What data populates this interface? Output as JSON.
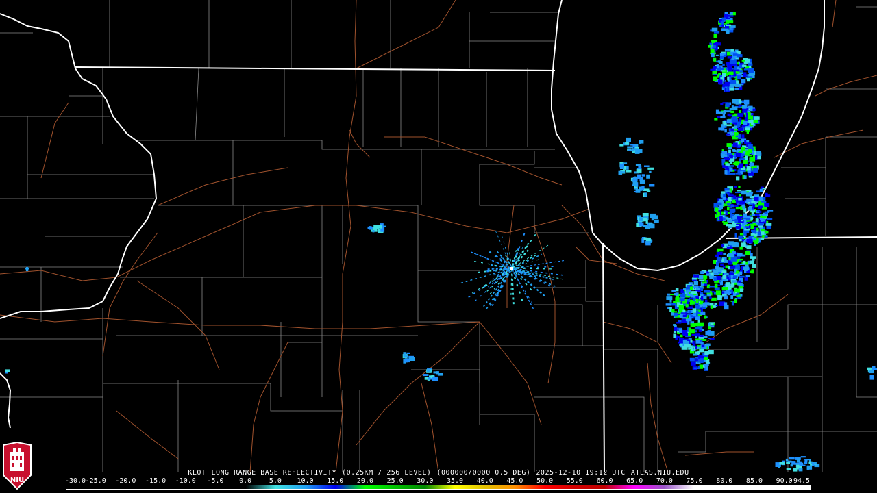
{
  "caption": {
    "site": "KLOT",
    "product": "LONG RANGE BASE REFLECTIVITY",
    "resolution": "(0.25KM / 256 LEVEL)",
    "scan": "(000000/0000 0.5 DEG)",
    "timestamp": "2025-12-10 19:12 UTC",
    "source": "ATLAS.NIU.EDU"
  },
  "colorbar": {
    "labels": [
      "-30.0",
      "-25.0",
      "-20.0",
      "-15.0",
      "-10.0",
      "-5.0",
      "0.0",
      "5.0",
      "10.0",
      "15.0",
      "20.0",
      "25.0",
      "30.0",
      "35.0",
      "40.0",
      "45.0",
      "50.0",
      "55.0",
      "60.0",
      "65.0",
      "70.0",
      "75.0",
      "80.0",
      "85.0",
      "90.0",
      "94.5"
    ],
    "min_dbz": -30.0,
    "max_dbz": 94.5,
    "stops": [
      {
        "dbz": -30,
        "color": "#000000"
      },
      {
        "dbz": 0,
        "color": "#000000"
      },
      {
        "dbz": 5,
        "color": "#40e0e0"
      },
      {
        "dbz": 10,
        "color": "#20a0f0"
      },
      {
        "dbz": 15,
        "color": "#0000f0"
      },
      {
        "dbz": 20,
        "color": "#00ff00"
      },
      {
        "dbz": 25,
        "color": "#00c000"
      },
      {
        "dbz": 30,
        "color": "#008800"
      },
      {
        "dbz": 35,
        "color": "#ffff00"
      },
      {
        "dbz": 40,
        "color": "#e0c000"
      },
      {
        "dbz": 45,
        "color": "#ff9000"
      },
      {
        "dbz": 50,
        "color": "#ff0000"
      },
      {
        "dbz": 55,
        "color": "#d00000"
      },
      {
        "dbz": 60,
        "color": "#c00000"
      },
      {
        "dbz": 65,
        "color": "#ff00ff"
      },
      {
        "dbz": 70,
        "color": "#9955c9"
      },
      {
        "dbz": 75,
        "color": "#ffffff"
      },
      {
        "dbz": 94.5,
        "color": "#ffffff"
      }
    ]
  },
  "logo": {
    "text": "NIU",
    "color": "#c8102e"
  },
  "colors": {
    "background": "#000000",
    "state_border": "#ffffff",
    "county_border": "#8a8a8a",
    "highway": "#a0522d",
    "shoreline": "#ffffff"
  },
  "legend_icons": [
    "radar-site-icon"
  ]
}
